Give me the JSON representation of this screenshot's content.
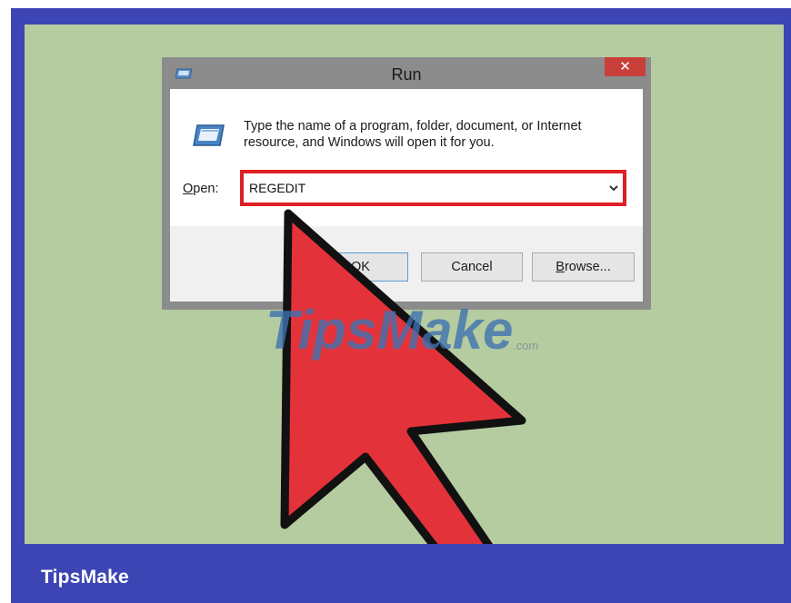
{
  "dialog": {
    "title": "Run",
    "close_label": "✕",
    "prompt": "Type the name of a program, folder, document, or Internet resource, and Windows will open it for you.",
    "open_label_accel": "O",
    "open_label_rest": "pen:",
    "open_value": "REGEDIT",
    "ok_label": "OK",
    "cancel_label": "Cancel",
    "browse_label_accel": "B",
    "browse_label_rest": "rowse..."
  },
  "watermark": {
    "text": "TipsMake",
    "suffix": ".com"
  },
  "footer": {
    "brand": "TipsMake"
  },
  "icons": [
    "run-title-icon",
    "run-program-icon",
    "chevron-down-icon",
    "mouse-cursor-icon"
  ],
  "colors": {
    "frame": "#3d45b5",
    "background": "#b5cca0",
    "highlight": "#dd1f26",
    "cursor": "#e4323b",
    "close": "#c9403a"
  }
}
